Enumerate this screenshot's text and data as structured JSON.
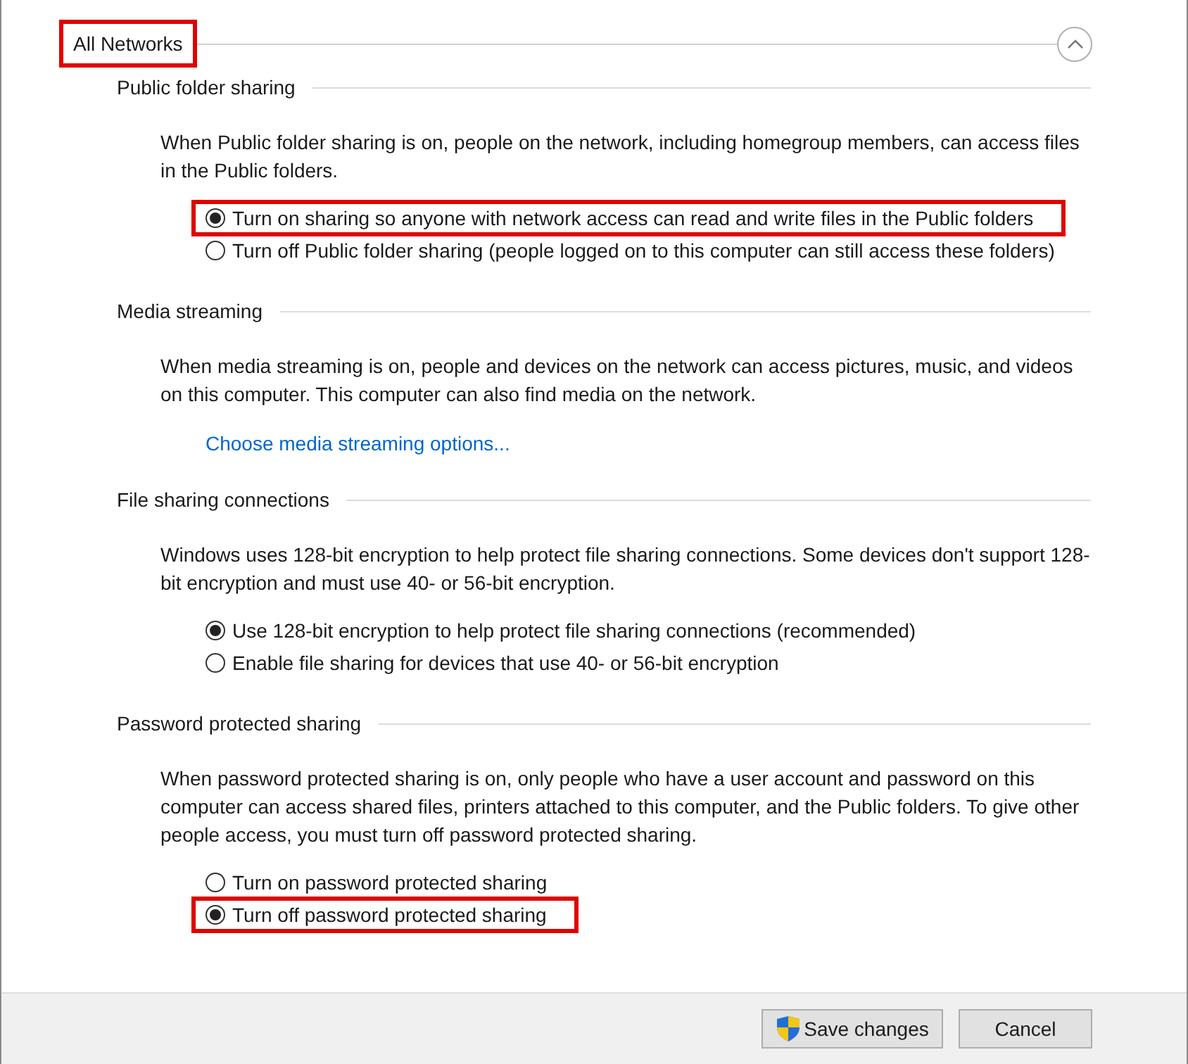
{
  "header": {
    "title": "All Networks",
    "highlighted": true,
    "expanded": true
  },
  "sections": [
    {
      "heading": "Public folder sharing",
      "paragraph": "When Public folder sharing is on, people on the network, including homegroup members, can access files in the Public folders.",
      "options": [
        {
          "label": "Turn on sharing so anyone with network access can read and write files in the Public folders",
          "selected": true,
          "highlighted": true
        },
        {
          "label": "Turn off Public folder sharing (people logged on to this computer can still access these folders)",
          "selected": false,
          "highlighted": false
        }
      ]
    },
    {
      "heading": "Media streaming",
      "paragraph": "When media streaming is on, people and devices on the network can access pictures, music, and videos on this computer. This computer can also find media on the network.",
      "link": "Choose media streaming options..."
    },
    {
      "heading": "File sharing connections",
      "paragraph": "Windows uses 128-bit encryption to help protect file sharing connections. Some devices don't support 128-bit encryption and must use 40- or 56-bit encryption.",
      "options": [
        {
          "label": "Use 128-bit encryption to help protect file sharing connections (recommended)",
          "selected": true,
          "highlighted": false
        },
        {
          "label": "Enable file sharing for devices that use 40- or 56-bit encryption",
          "selected": false,
          "highlighted": false
        }
      ]
    },
    {
      "heading": "Password protected sharing",
      "paragraph": "When password protected sharing is on, only people who have a user account and password on this computer can access shared files, printers attached to this computer, and the Public folders. To give other people access, you must turn off password protected sharing.",
      "options": [
        {
          "label": "Turn on password protected sharing",
          "selected": false,
          "highlighted": false
        },
        {
          "label": "Turn off password protected sharing",
          "selected": true,
          "highlighted": true
        }
      ]
    }
  ],
  "buttons": [
    {
      "label": "Save changes",
      "kind": "shield"
    },
    {
      "label": "Cancel",
      "kind": "plain"
    }
  ]
}
